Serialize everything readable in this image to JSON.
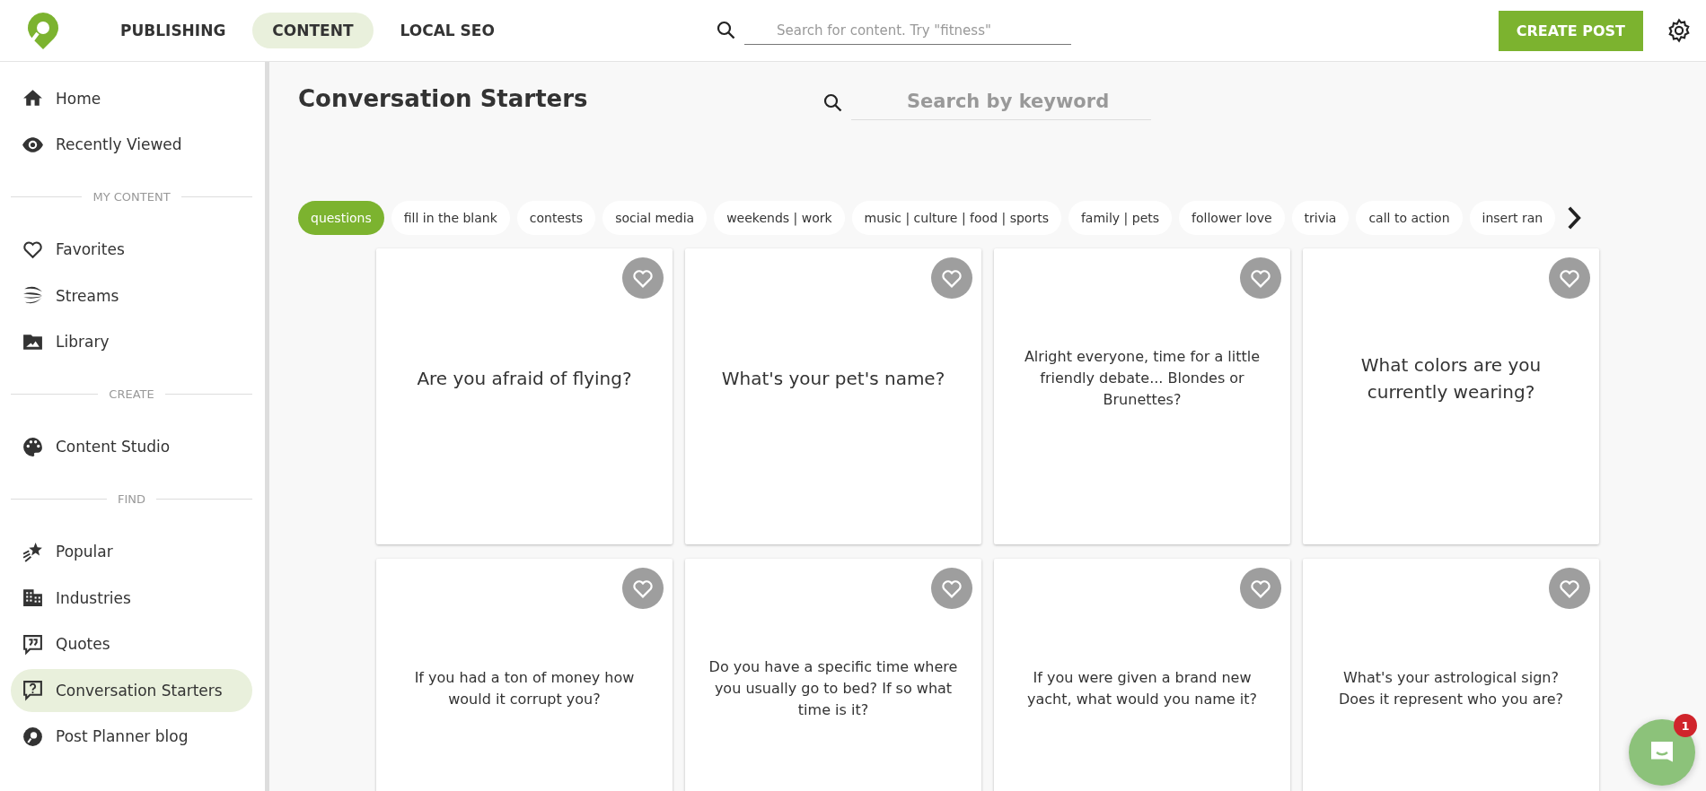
{
  "header": {
    "nav": [
      {
        "label": "PUBLISHING",
        "selected": false
      },
      {
        "label": "CONTENT",
        "selected": true
      },
      {
        "label": "LOCAL SEO",
        "selected": false
      }
    ],
    "search": {
      "placeholder": "Search for content. Try \"fitness\""
    },
    "create_button": "CREATE POST"
  },
  "sidebar": {
    "groups": [
      {
        "items": [
          {
            "label": "Home",
            "selected": false
          },
          {
            "label": "Recently Viewed",
            "selected": false
          }
        ]
      },
      {
        "heading": "MY CONTENT",
        "items": [
          {
            "label": "Favorites",
            "selected": false
          },
          {
            "label": "Streams",
            "selected": false
          },
          {
            "label": "Library",
            "selected": false
          }
        ]
      },
      {
        "heading": "CREATE",
        "items": [
          {
            "label": "Content Studio",
            "selected": false
          }
        ]
      },
      {
        "heading": "FIND",
        "items": [
          {
            "label": "Popular",
            "selected": false
          },
          {
            "label": "Industries",
            "selected": false
          },
          {
            "label": "Quotes",
            "selected": false
          },
          {
            "label": "Conversation Starters",
            "selected": true
          },
          {
            "label": "Post Planner blog",
            "selected": false
          }
        ]
      }
    ]
  },
  "page": {
    "title": "Conversation Starters",
    "search": {
      "placeholder": "Search by keyword"
    },
    "chips": [
      {
        "label": "questions",
        "selected": true
      },
      {
        "label": "fill in the blank",
        "selected": false
      },
      {
        "label": "contests",
        "selected": false
      },
      {
        "label": "social media",
        "selected": false
      },
      {
        "label": "weekends | work",
        "selected": false
      },
      {
        "label": "music | culture | food | sports",
        "selected": false
      },
      {
        "label": "family | pets",
        "selected": false
      },
      {
        "label": "follower love",
        "selected": false
      },
      {
        "label": "trivia",
        "selected": false
      },
      {
        "label": "call to action",
        "selected": false
      },
      {
        "label": "insert ran",
        "selected": false
      }
    ],
    "cards": [
      {
        "text": "Are you afraid of flying?"
      },
      {
        "text": "What's your pet's name?"
      },
      {
        "text": "Alright everyone, time for a little friendly debate... Blondes or Brunettes?"
      },
      {
        "text": "What colors are you currently wearing?"
      },
      {
        "text": "If you had a ton of money how would it corrupt you?"
      },
      {
        "text": "Do you have a specific time where you usually go to bed? If so what time is it?"
      },
      {
        "text": "If you were given a brand new yacht, what would you name it?"
      },
      {
        "text": "What's your astrological sign? Does it represent who you are?"
      }
    ]
  },
  "chat": {
    "badge": "1"
  }
}
